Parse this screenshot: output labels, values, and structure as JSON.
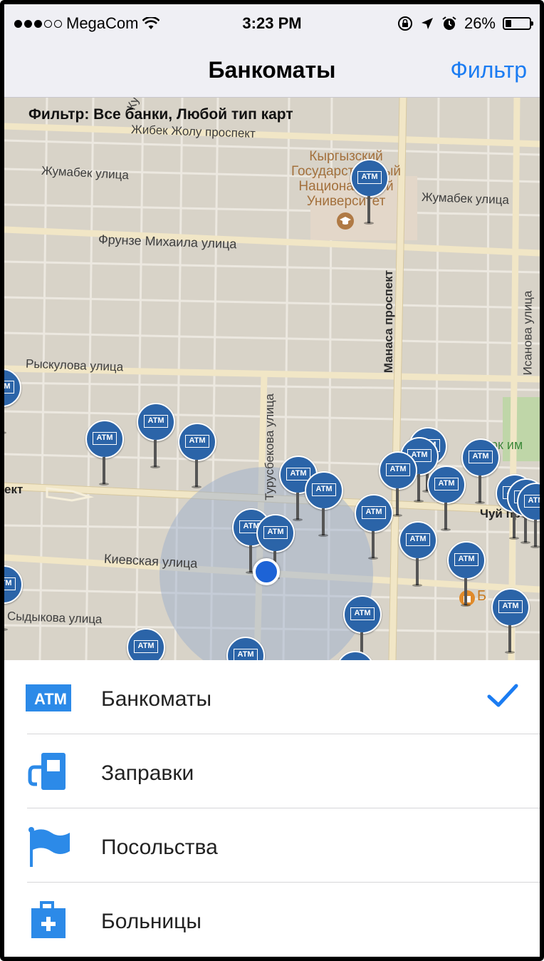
{
  "status_bar": {
    "carrier": "MegaCom",
    "time": "3:23 PM",
    "battery": "26%"
  },
  "nav": {
    "title": "Банкоматы",
    "filter_button": "Фильтр"
  },
  "map": {
    "filter_text": "Фильтр: Все банки, Любой тип карт",
    "streets": {
      "zhibek": "Жибек Жолу проспект",
      "zhumabek_left": "Жумабек улица",
      "zhumabek_right": "Жумабек улица",
      "frunze": "Фрунзе Михаила улица",
      "manasa": "Манаса проспект",
      "ryskulova": "Рыскулова улица",
      "turusbekova": "Турусбекова улица",
      "isanova": "Исанова улица",
      "kievskaya": "Киевская улица",
      "sydykova": "Сыдыкова улица",
      "chuy": "Чуй просп",
      "prospekt_left": "ект",
      "university": "Кыргызский Государственный Национальный Университет",
      "park": "Парк им Гор",
      "bank_label": "Б",
      "ky": "Ку"
    },
    "atm_label": "ATM"
  },
  "categories": [
    {
      "label": "Банкоматы",
      "icon": "atm-icon",
      "selected": true
    },
    {
      "label": "Заправки",
      "icon": "fuel-pump-icon",
      "selected": false
    },
    {
      "label": "Посольства",
      "icon": "flag-icon",
      "selected": false
    },
    {
      "label": "Больницы",
      "icon": "first-aid-kit-icon",
      "selected": false
    }
  ],
  "colors": {
    "accent": "#1b7cf2",
    "atm_pin": "#2b64a8",
    "user_location": "#1d63d6"
  }
}
